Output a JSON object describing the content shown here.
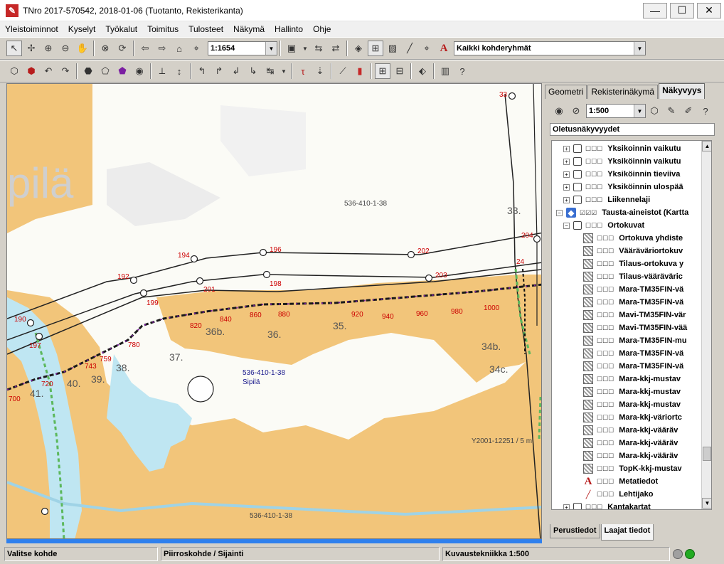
{
  "window": {
    "title": "TNro 2017-570542, 2018-01-06 (Tuotanto, Rekisterikanta)",
    "controls": [
      "—",
      "☐",
      "✕"
    ]
  },
  "menu": [
    "Yleistoiminnot",
    "Kyselyt",
    "Työkalut",
    "Toimitus",
    "Tulosteet",
    "Näkymä",
    "Hallinto",
    "Ohje"
  ],
  "toolbar": {
    "scale": "1:1654",
    "group": "Kaikki kohderyhmät",
    "text_tool": "A"
  },
  "map": {
    "parcel_ids": [
      "536-410-1-38",
      "536-410-1-38",
      "536-410-1-38"
    ],
    "parcel_name": "Sipilä",
    "place_name": "pilä",
    "ortho_label": "Y2001-12251 / 5 m",
    "points": [
      "33",
      "204",
      "194",
      "196",
      "202",
      "192",
      "203",
      "198",
      "201",
      "190",
      "199",
      "24",
      "197",
      "743",
      "33."
    ],
    "chainage": [
      "720",
      "700",
      "759",
      "780",
      "820",
      "840",
      "860",
      "880",
      "920",
      "940",
      "960",
      "980",
      "1000"
    ],
    "parcels": [
      "36b.",
      "36.",
      "35.",
      "34b.",
      "34c.",
      "38.",
      "37.",
      "39.",
      "40.",
      "41."
    ]
  },
  "right_panel": {
    "tabs": [
      "Geometri",
      "Rekisterinäkymä",
      "Näkyvyys"
    ],
    "scale": "1:500",
    "view_name": "Oletusnäkyvyydet",
    "tree": [
      {
        "label": "Yksikoinnin vaikutu",
        "icon": "cube",
        "pm": "+"
      },
      {
        "label": "Yksiköinnin vaikutu",
        "icon": "cube",
        "pm": "+"
      },
      {
        "label": "Yksiköinnin tieviiva",
        "icon": "cube",
        "pm": "+"
      },
      {
        "label": "Yksiköinnin ulospää",
        "icon": "cube",
        "pm": "+"
      },
      {
        "label": "Liikennelaji",
        "icon": "cube",
        "pm": "+"
      },
      {
        "label": "Tausta-aineistot (Kartta",
        "icon": "db",
        "pm": "−"
      },
      {
        "label": "Ortokuvat",
        "icon": "cube",
        "pm": "−"
      },
      {
        "label": "Ortokuva yhdiste",
        "icon": "img",
        "pm": ""
      },
      {
        "label": "Vääräväriortokuv",
        "icon": "img",
        "pm": ""
      },
      {
        "label": "Tilaus-ortokuva y",
        "icon": "img",
        "pm": ""
      },
      {
        "label": "Tilaus-vääräväric",
        "icon": "img",
        "pm": ""
      },
      {
        "label": "Mara-TM35FIN-vä",
        "icon": "img",
        "pm": ""
      },
      {
        "label": "Mara-TM35FIN-vä",
        "icon": "img",
        "pm": ""
      },
      {
        "label": "Mavi-TM35FIN-vär",
        "icon": "img",
        "pm": ""
      },
      {
        "label": "Mavi-TM35FIN-vää",
        "icon": "img",
        "pm": ""
      },
      {
        "label": "Mara-TM35FIN-mu",
        "icon": "img",
        "pm": ""
      },
      {
        "label": "Mara-TM35FIN-vä",
        "icon": "img",
        "pm": ""
      },
      {
        "label": "Mara-TM35FIN-vä",
        "icon": "img",
        "pm": ""
      },
      {
        "label": "Mara-kkj-mustav",
        "icon": "img",
        "pm": ""
      },
      {
        "label": "Mara-kkj-mustav",
        "icon": "img",
        "pm": ""
      },
      {
        "label": "Mara-kkj-mustav",
        "icon": "img",
        "pm": ""
      },
      {
        "label": "Mara-kkj-väriortc",
        "icon": "img",
        "pm": ""
      },
      {
        "label": "Mara-kkj-vääräv",
        "icon": "img",
        "pm": ""
      },
      {
        "label": "Mara-kkj-vääräv",
        "icon": "img",
        "pm": ""
      },
      {
        "label": "Mara-kkj-vääräv",
        "icon": "img",
        "pm": ""
      },
      {
        "label": "TopK-kkj-mustav",
        "icon": "img",
        "pm": ""
      },
      {
        "label": "Metatiedot",
        "icon": "a",
        "pm": ""
      },
      {
        "label": "Lehtijako",
        "icon": "line",
        "pm": ""
      },
      {
        "label": "Kantakartat",
        "icon": "cube",
        "pm": "+"
      }
    ],
    "bottom_tabs": [
      "Perustiedot",
      "Laajat tiedot"
    ]
  },
  "status": {
    "left": "Valitse kohde",
    "middle": "Piirroskohde / Sijainti",
    "right": "Kuvaustekniikka 1:500"
  },
  "colors": {
    "terrain": "#f2c57a",
    "water": "#bfe6f2",
    "red": "#cc0000",
    "status_green": "#22aa22"
  }
}
